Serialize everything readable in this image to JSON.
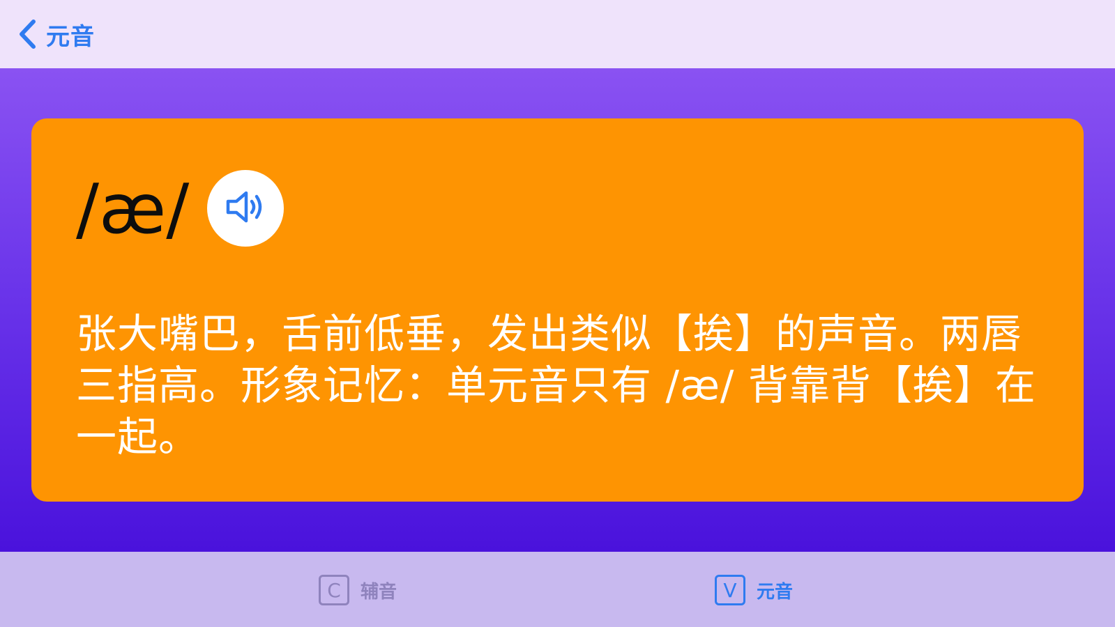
{
  "nav": {
    "back_label": "元音"
  },
  "card": {
    "symbol": "/æ/",
    "play_icon": "speaker-icon",
    "description": "张大嘴巴，舌前低垂，发出类似【挨】的声音。两唇三指高。形象记忆：单元音只有 /æ/ 背靠背【挨】在一起。"
  },
  "tabs": [
    {
      "icon_letter": "C",
      "label": "辅音",
      "active": false
    },
    {
      "icon_letter": "V",
      "label": "元音",
      "active": true
    }
  ],
  "colors": {
    "nav_background": "#efe3fb",
    "accent_blue": "#2f7bf0",
    "gradient_top": "#8a52f2",
    "gradient_bottom": "#4a12dc",
    "card_orange": "#fe9402",
    "tab_bar_background": "#c8b9ef",
    "tab_inactive": "#8f83bd"
  }
}
